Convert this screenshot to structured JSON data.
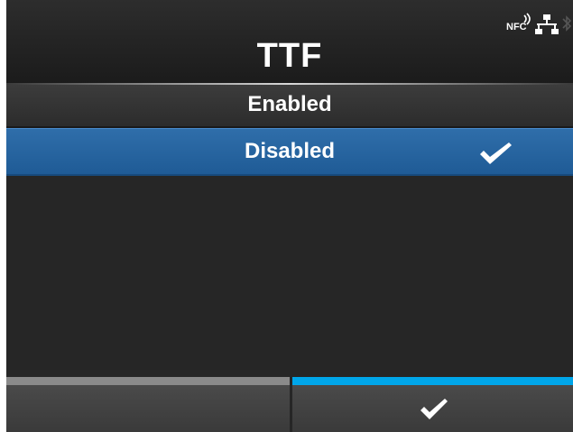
{
  "header": {
    "title": "TTF",
    "status_icons": [
      "nfc-icon",
      "network-icon",
      "bluetooth-icon"
    ],
    "nfc_label": "NFC"
  },
  "list": {
    "items": [
      {
        "label": "Enabled",
        "selected": false
      },
      {
        "label": "Disabled",
        "selected": true
      }
    ],
    "selected_marker": "checkmark-icon"
  },
  "footer": {
    "left_button": {
      "icon": "none",
      "accent_color": "#8a8a8a"
    },
    "right_button": {
      "icon": "checkmark-icon",
      "accent_color": "#00a6ea"
    }
  },
  "colors": {
    "selected_row": "#1f5b96",
    "background": "#262626",
    "accent": "#00a6ea"
  }
}
